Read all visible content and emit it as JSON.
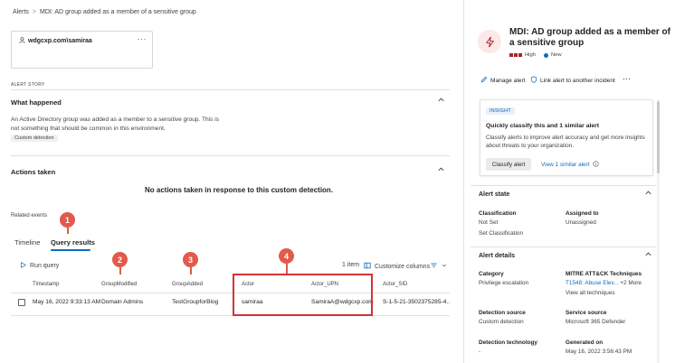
{
  "breadcrumb": {
    "root": "Alerts",
    "separator": ">",
    "current": "MDI: AD group added as a member of a sensitive group"
  },
  "entity_card": {
    "name": "wdgcxp.com\\samiraa",
    "more": "···"
  },
  "alert_story_label": "ALERT STORY",
  "what_happened": {
    "title": "What happened",
    "description": "An Active Directory group was added as a member to a sensitive group. This is not something that should be common in this environment.",
    "chip": "Custom detection"
  },
  "actions_taken": {
    "title": "Actions taken",
    "empty_message": "No actions taken in response to this custom detection."
  },
  "related_events": {
    "label": "Related events",
    "tabs": [
      {
        "label": "Timeline"
      },
      {
        "label": "Query results"
      }
    ],
    "run_query": "Run query",
    "item_count": "1 item",
    "customize_columns": "Customize columns",
    "columns": [
      "Timestamp",
      "GroupModified",
      "GroupAdded",
      "Actor",
      "Actor_UPN",
      "Actor_SID"
    ],
    "row": [
      "May 16, 2022 9:33:13 AM",
      "Domain Admins",
      "TestGroupforBlog",
      "samiraa",
      "SamiraA@wdgcxp.com",
      "S-1-5-21-3502375285-4..."
    ]
  },
  "callouts": [
    "1",
    "2",
    "3",
    "4"
  ],
  "highlight_color": "#d13438",
  "right_panel": {
    "title": "MDI: AD group added as a member of a sensitive group",
    "severity": "High",
    "status": "New",
    "manage_alert": "Manage alert",
    "link_alert": "Link alert to another incident",
    "more": "···",
    "insight": {
      "tag": "INSIGHT",
      "title": "Quickly classify this and 1 similar alert",
      "text": "Classify alerts to improve alert accuracy and get more insights about threats to your organization.",
      "classify_button": "Classify alert",
      "similar_link": "View 1 similar alert"
    },
    "alert_state": {
      "title": "Alert state",
      "classification_label": "Classification",
      "classification_value": "Not Set",
      "assigned_label": "Assigned to",
      "assigned_value": "Unassigned",
      "set_classification": "Set Classification"
    },
    "alert_details": {
      "title": "Alert details",
      "category_label": "Category",
      "category_value": "Privilege escalation",
      "mitre_label": "MITRE ATT&CK Techniques",
      "mitre_value": "T1548: Abuse Elev...",
      "mitre_more": "+2 More",
      "view_all": "View all techniques",
      "detection_source_label": "Detection source",
      "detection_source_value": "Custom detection",
      "service_source_label": "Service source",
      "service_source_value": "Microsoft 365 Defender",
      "detection_tech_label": "Detection technology",
      "detection_tech_value": "-",
      "generated_label": "Generated on",
      "generated_value": "May 16, 2022 3:56:43 PM"
    }
  }
}
